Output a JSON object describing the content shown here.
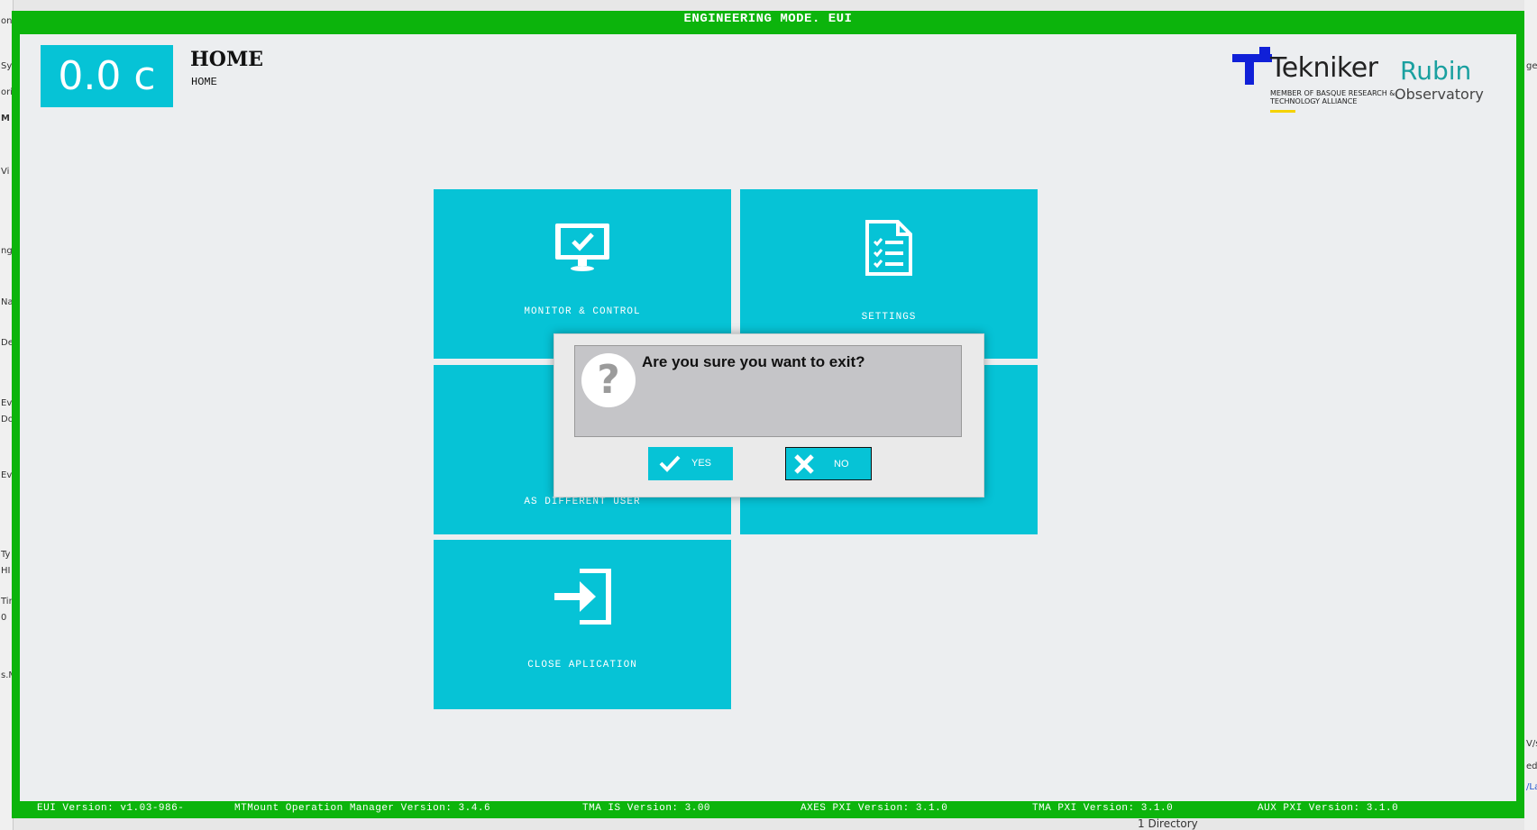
{
  "window": {
    "title": "ENGINEERING MODE. EUI"
  },
  "header": {
    "temperature": "0.0 c",
    "title": "HOME",
    "breadcrumb": "HOME"
  },
  "logos": {
    "tekniker": "Tekniker",
    "tekniker_sub": "MEMBER OF BASQUE RESEARCH & TECHNOLOGY ALLIANCE",
    "rubin": "Rubin",
    "observatory": "Observatory"
  },
  "tiles": {
    "monitor_control": "MONITOR & CONTROL",
    "settings": "SETTINGS",
    "as_different_user": "AS DIFFERENT USER",
    "close_application": "CLOSE APLICATION"
  },
  "dialog": {
    "message": "Are you sure you want to exit?",
    "yes_label": "YES",
    "no_label": "NO"
  },
  "footer": {
    "eui_version": "EUI Version: v1.03-986-",
    "operation_manager": "MTMount Operation Manager Version: 3.4.6",
    "tma_is": "TMA IS Version: 3.00",
    "axes_pxi": "AXES PXI Version: 3.1.0",
    "tma_pxi": "TMA PXI Version: 3.1.0",
    "aux_pxi": "AUX PXI Version: 3.1.0"
  },
  "background": {
    "left_fragments": [
      "on",
      "Sy",
      "ori",
      "M",
      "Vi",
      "ngs",
      "Na",
      "De",
      "Ev",
      "Do",
      "Ev",
      "Ty",
      "HI",
      "Tir",
      "0",
      "s.M"
    ],
    "right_fragments": [
      "ge",
      "V/s",
      "ed",
      "/La"
    ],
    "bottom_text": "1 Directory"
  },
  "colors": {
    "frame": "#0cb40c",
    "tile": "#06c3d6",
    "client_bg": "#eceef0"
  }
}
